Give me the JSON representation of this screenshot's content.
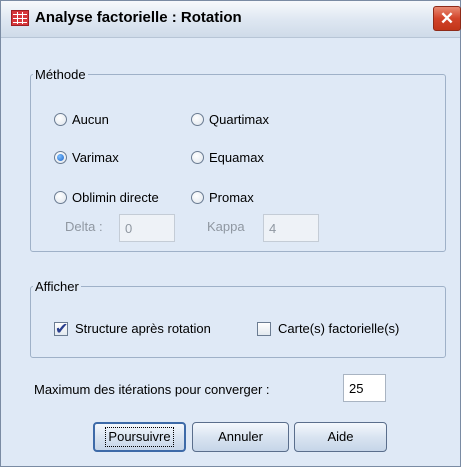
{
  "window": {
    "title": "Analyse factorielle : Rotation",
    "close_label": "✕"
  },
  "method": {
    "legend": "Méthode",
    "options": [
      {
        "label": "Aucun",
        "accel": "n",
        "selected": false
      },
      {
        "label": "Varimax",
        "accel": "V",
        "selected": true
      },
      {
        "label": "Oblimin directe",
        "accel": "O",
        "selected": false
      },
      {
        "label": "Quartimax",
        "accel": "Q",
        "selected": false
      },
      {
        "label": "Equamax",
        "accel": "E",
        "selected": false
      },
      {
        "label": "Promax",
        "accel": "P",
        "selected": false
      }
    ],
    "delta": {
      "label": "Delta :",
      "value": "0",
      "enabled": false
    },
    "kappa": {
      "label": "Kappa",
      "value": "4",
      "enabled": false
    }
  },
  "display": {
    "legend": "Afficher",
    "rotated_solution": {
      "label": "Structure après rotation",
      "checked": true
    },
    "loading_plots": {
      "label": "Carte(s) factorielle(s)",
      "checked": false
    }
  },
  "iterations": {
    "label": "Maximum des itérations pour converger :",
    "value": "25"
  },
  "buttons": {
    "continue": "Poursuivre",
    "cancel": "Annuler",
    "help": "Aide"
  },
  "colors": {
    "dialog_bg": "#dfe9f6",
    "close_button": "#d2442a",
    "group_border": "#9fb1c8"
  }
}
